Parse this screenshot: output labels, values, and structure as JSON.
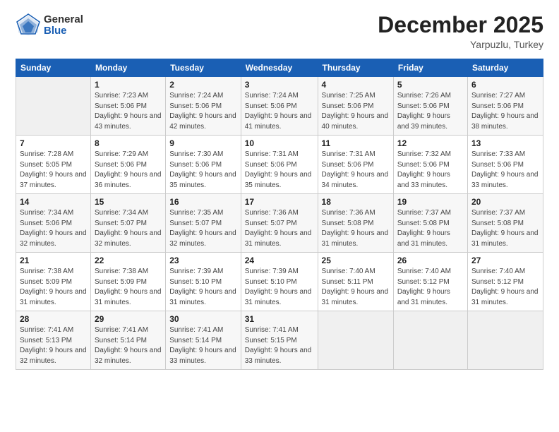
{
  "header": {
    "logo_general": "General",
    "logo_blue": "Blue",
    "month": "December 2025",
    "location": "Yarpuzlu, Turkey"
  },
  "weekdays": [
    "Sunday",
    "Monday",
    "Tuesday",
    "Wednesday",
    "Thursday",
    "Friday",
    "Saturday"
  ],
  "weeks": [
    [
      {
        "day": "",
        "empty": true
      },
      {
        "day": "1",
        "sunrise": "Sunrise: 7:23 AM",
        "sunset": "Sunset: 5:06 PM",
        "daylight": "Daylight: 9 hours and 43 minutes."
      },
      {
        "day": "2",
        "sunrise": "Sunrise: 7:24 AM",
        "sunset": "Sunset: 5:06 PM",
        "daylight": "Daylight: 9 hours and 42 minutes."
      },
      {
        "day": "3",
        "sunrise": "Sunrise: 7:24 AM",
        "sunset": "Sunset: 5:06 PM",
        "daylight": "Daylight: 9 hours and 41 minutes."
      },
      {
        "day": "4",
        "sunrise": "Sunrise: 7:25 AM",
        "sunset": "Sunset: 5:06 PM",
        "daylight": "Daylight: 9 hours and 40 minutes."
      },
      {
        "day": "5",
        "sunrise": "Sunrise: 7:26 AM",
        "sunset": "Sunset: 5:06 PM",
        "daylight": "Daylight: 9 hours and 39 minutes."
      },
      {
        "day": "6",
        "sunrise": "Sunrise: 7:27 AM",
        "sunset": "Sunset: 5:06 PM",
        "daylight": "Daylight: 9 hours and 38 minutes."
      }
    ],
    [
      {
        "day": "7",
        "sunrise": "Sunrise: 7:28 AM",
        "sunset": "Sunset: 5:05 PM",
        "daylight": "Daylight: 9 hours and 37 minutes."
      },
      {
        "day": "8",
        "sunrise": "Sunrise: 7:29 AM",
        "sunset": "Sunset: 5:06 PM",
        "daylight": "Daylight: 9 hours and 36 minutes."
      },
      {
        "day": "9",
        "sunrise": "Sunrise: 7:30 AM",
        "sunset": "Sunset: 5:06 PM",
        "daylight": "Daylight: 9 hours and 35 minutes."
      },
      {
        "day": "10",
        "sunrise": "Sunrise: 7:31 AM",
        "sunset": "Sunset: 5:06 PM",
        "daylight": "Daylight: 9 hours and 35 minutes."
      },
      {
        "day": "11",
        "sunrise": "Sunrise: 7:31 AM",
        "sunset": "Sunset: 5:06 PM",
        "daylight": "Daylight: 9 hours and 34 minutes."
      },
      {
        "day": "12",
        "sunrise": "Sunrise: 7:32 AM",
        "sunset": "Sunset: 5:06 PM",
        "daylight": "Daylight: 9 hours and 33 minutes."
      },
      {
        "day": "13",
        "sunrise": "Sunrise: 7:33 AM",
        "sunset": "Sunset: 5:06 PM",
        "daylight": "Daylight: 9 hours and 33 minutes."
      }
    ],
    [
      {
        "day": "14",
        "sunrise": "Sunrise: 7:34 AM",
        "sunset": "Sunset: 5:06 PM",
        "daylight": "Daylight: 9 hours and 32 minutes."
      },
      {
        "day": "15",
        "sunrise": "Sunrise: 7:34 AM",
        "sunset": "Sunset: 5:07 PM",
        "daylight": "Daylight: 9 hours and 32 minutes."
      },
      {
        "day": "16",
        "sunrise": "Sunrise: 7:35 AM",
        "sunset": "Sunset: 5:07 PM",
        "daylight": "Daylight: 9 hours and 32 minutes."
      },
      {
        "day": "17",
        "sunrise": "Sunrise: 7:36 AM",
        "sunset": "Sunset: 5:07 PM",
        "daylight": "Daylight: 9 hours and 31 minutes."
      },
      {
        "day": "18",
        "sunrise": "Sunrise: 7:36 AM",
        "sunset": "Sunset: 5:08 PM",
        "daylight": "Daylight: 9 hours and 31 minutes."
      },
      {
        "day": "19",
        "sunrise": "Sunrise: 7:37 AM",
        "sunset": "Sunset: 5:08 PM",
        "daylight": "Daylight: 9 hours and 31 minutes."
      },
      {
        "day": "20",
        "sunrise": "Sunrise: 7:37 AM",
        "sunset": "Sunset: 5:08 PM",
        "daylight": "Daylight: 9 hours and 31 minutes."
      }
    ],
    [
      {
        "day": "21",
        "sunrise": "Sunrise: 7:38 AM",
        "sunset": "Sunset: 5:09 PM",
        "daylight": "Daylight: 9 hours and 31 minutes."
      },
      {
        "day": "22",
        "sunrise": "Sunrise: 7:38 AM",
        "sunset": "Sunset: 5:09 PM",
        "daylight": "Daylight: 9 hours and 31 minutes."
      },
      {
        "day": "23",
        "sunrise": "Sunrise: 7:39 AM",
        "sunset": "Sunset: 5:10 PM",
        "daylight": "Daylight: 9 hours and 31 minutes."
      },
      {
        "day": "24",
        "sunrise": "Sunrise: 7:39 AM",
        "sunset": "Sunset: 5:10 PM",
        "daylight": "Daylight: 9 hours and 31 minutes."
      },
      {
        "day": "25",
        "sunrise": "Sunrise: 7:40 AM",
        "sunset": "Sunset: 5:11 PM",
        "daylight": "Daylight: 9 hours and 31 minutes."
      },
      {
        "day": "26",
        "sunrise": "Sunrise: 7:40 AM",
        "sunset": "Sunset: 5:12 PM",
        "daylight": "Daylight: 9 hours and 31 minutes."
      },
      {
        "day": "27",
        "sunrise": "Sunrise: 7:40 AM",
        "sunset": "Sunset: 5:12 PM",
        "daylight": "Daylight: 9 hours and 31 minutes."
      }
    ],
    [
      {
        "day": "28",
        "sunrise": "Sunrise: 7:41 AM",
        "sunset": "Sunset: 5:13 PM",
        "daylight": "Daylight: 9 hours and 32 minutes."
      },
      {
        "day": "29",
        "sunrise": "Sunrise: 7:41 AM",
        "sunset": "Sunset: 5:14 PM",
        "daylight": "Daylight: 9 hours and 32 minutes."
      },
      {
        "day": "30",
        "sunrise": "Sunrise: 7:41 AM",
        "sunset": "Sunset: 5:14 PM",
        "daylight": "Daylight: 9 hours and 33 minutes."
      },
      {
        "day": "31",
        "sunrise": "Sunrise: 7:41 AM",
        "sunset": "Sunset: 5:15 PM",
        "daylight": "Daylight: 9 hours and 33 minutes."
      },
      {
        "day": "",
        "empty": true
      },
      {
        "day": "",
        "empty": true
      },
      {
        "day": "",
        "empty": true
      }
    ]
  ]
}
